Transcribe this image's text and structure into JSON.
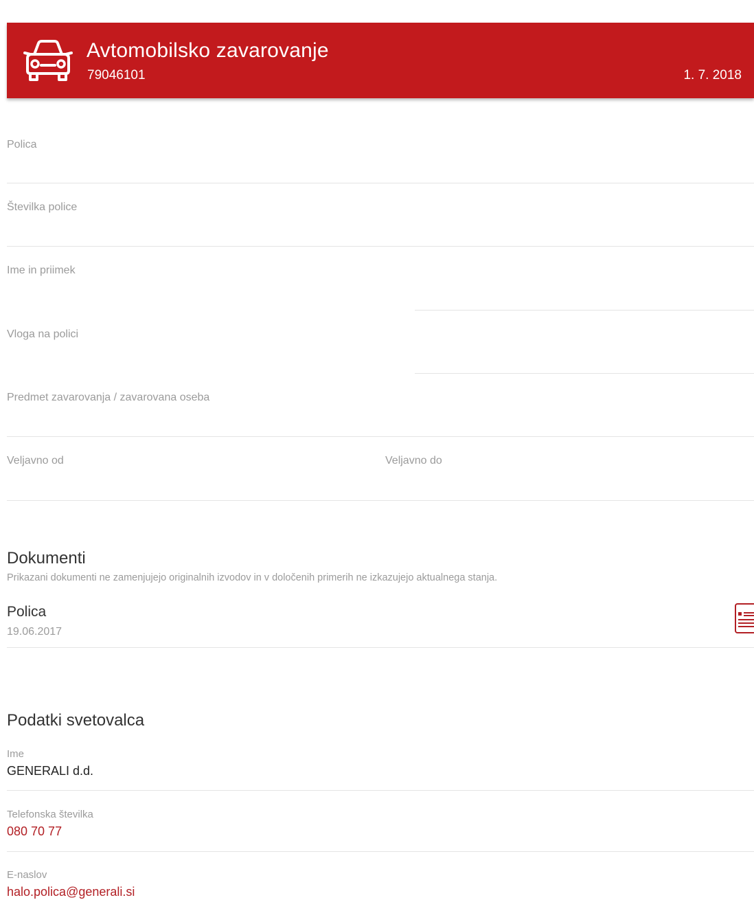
{
  "header": {
    "title": "Avtomobilsko zavarovanje",
    "policy_number": "79046101",
    "date": "1. 7. 2018",
    "icon": "car-icon",
    "background_color": "#c21a1d"
  },
  "fields": {
    "policy": "Polica",
    "policy_number": "Številka police",
    "name": "Ime in priimek",
    "role": "Vloga na polici",
    "insured_object": "Predmet zavarovanja / zavarovana oseba",
    "valid_from": "Veljavno od",
    "valid_to": "Veljavno do"
  },
  "documents": {
    "title": "Dokumenti",
    "note": "Prikazani dokumenti ne zamenjujejo originalnih izvodov in v določenih primerih ne izkazujejo aktualnega stanja.",
    "items": [
      {
        "title": "Polica",
        "date": "19.06.2017",
        "icon": "document-icon"
      }
    ]
  },
  "advisor": {
    "title": "Podatki svetovalca",
    "name_label": "Ime",
    "name_value": "GENERALI d.d.",
    "phone_label": "Telefonska številka",
    "phone_value": "080 70 77",
    "email_label": "E-naslov",
    "email_value": "halo.polica@generali.si",
    "link_color": "#b21f24"
  }
}
